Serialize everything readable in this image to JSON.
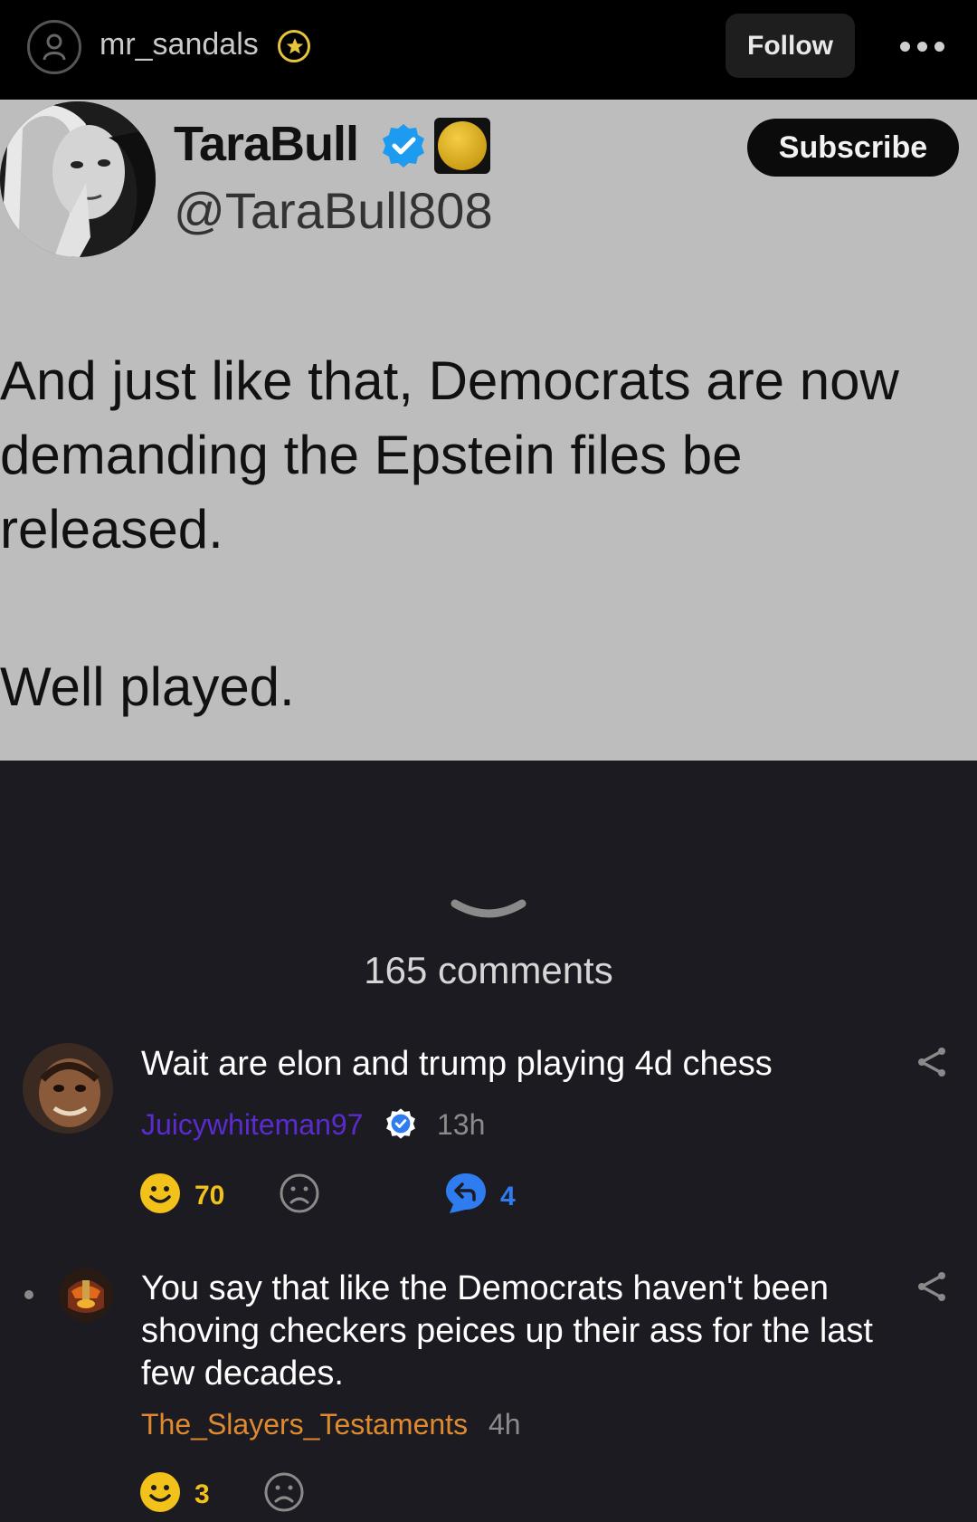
{
  "topbar": {
    "username": "mr_sandals",
    "follow_label": "Follow"
  },
  "tweet": {
    "display_name": "TaraBull",
    "handle": "@TaraBull808",
    "subscribe_label": "Subscribe",
    "body_line1": "And just like that, Democrats are now demanding the Epstein files be released.",
    "body_line2": "Well played."
  },
  "comments": {
    "count_label": "165 comments",
    "items": [
      {
        "text": "Wait are elon and trump playing 4d chess",
        "user": "Juicywhiteman97",
        "time": "13h",
        "likes": "70",
        "replies": "4",
        "user_color": "#5b2bd0"
      },
      {
        "text": "You say that like the Democrats haven't been shoving checkers peices up their ass for the last few decades.",
        "user": "The_Slayers_Testaments",
        "time": "4h",
        "likes": "3",
        "user_color": "#e08a30"
      }
    ]
  },
  "colors": {
    "accent_yellow": "#f2c21a",
    "reply_blue": "#2f7bf0",
    "verified_blue": "#1d9bf0"
  }
}
